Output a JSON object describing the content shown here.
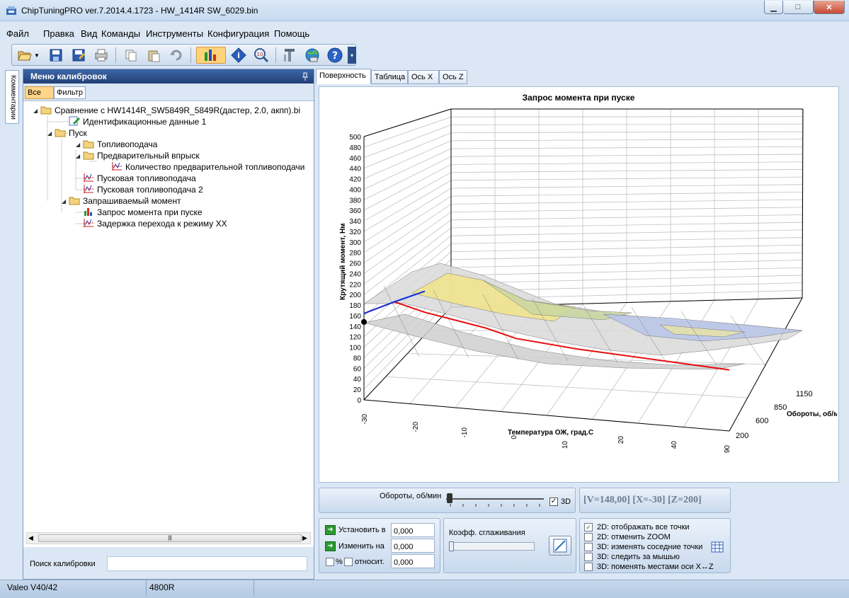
{
  "window": {
    "title": "ChipTuningPRO ver.7.2014.4.1723 - HW_1414R SW_6029.bin",
    "min_glyph": "▁",
    "max_glyph": "□",
    "close_glyph": "✕"
  },
  "menu": [
    "Файл",
    "Правка",
    "Вид",
    "Команды",
    "Инструменты",
    "Конфигурация",
    "Помощь"
  ],
  "side_tab": "Комментарии",
  "left_panel": {
    "title": "Меню калибровок",
    "filter_buttons": [
      "Все",
      "Фильтр"
    ],
    "tree": [
      {
        "label": "Сравнение с HW1414R_SW5849R_5849R(дастер, 2.0, акпп).bi",
        "icon": "folder-icon",
        "level": 0,
        "expand": "◢"
      },
      {
        "label": "Идентификационные данные 1",
        "icon": "edit-icon",
        "level": 1,
        "expand": ""
      },
      {
        "label": "Пуск",
        "icon": "folder-icon",
        "level": 1,
        "expand": "◢"
      },
      {
        "label": "Топливоподача",
        "icon": "folder-icon",
        "level": 2,
        "expand": "◢"
      },
      {
        "label": "Предварительный впрыск",
        "icon": "folder-icon",
        "level": 3,
        "expand": "◢"
      },
      {
        "label": "Количество предварительной топливоподачи",
        "icon": "chart-line-icon",
        "level": 4,
        "expand": ""
      },
      {
        "label": "Пусковая топливоподача",
        "icon": "chart-line-icon",
        "level": 3,
        "expand": ""
      },
      {
        "label": "Пусковая топливоподача 2",
        "icon": "chart-line-icon",
        "level": 3,
        "expand": ""
      },
      {
        "label": "Запрашиваемый момент",
        "icon": "folder-icon",
        "level": 2,
        "expand": "◢"
      },
      {
        "label": "Запрос момента при пуске",
        "icon": "chart-3d-icon",
        "level": 3,
        "expand": ""
      },
      {
        "label": "Задержка перехода к режиму XX",
        "icon": "chart-line-icon",
        "level": 3,
        "expand": ""
      }
    ],
    "search_label": "Поиск калибровки",
    "search_value": "",
    "scroll_grip": "|||"
  },
  "tabs": [
    "Поверхность",
    "Таблица",
    "Ось X",
    "Ось Z"
  ],
  "chart_data": {
    "type": "surface3d",
    "title": "Запрос момента при пуске",
    "zlabel": "Крутящий момент, Нм",
    "xlabel": "Температура ОЖ, град.С",
    "ylabel": "Обороты, об/м",
    "z_ticks": [
      "0",
      "20",
      "40",
      "60",
      "80",
      "100",
      "120",
      "140",
      "160",
      "180",
      "200",
      "220",
      "240",
      "260",
      "280",
      "300",
      "320",
      "340",
      "360",
      "380",
      "400",
      "420",
      "440",
      "460",
      "480",
      "500"
    ],
    "x_ticks": [
      "-30",
      "-20",
      "-10",
      "0",
      "10",
      "20",
      "40",
      "90"
    ],
    "y_ticks": [
      "200",
      "600",
      "850",
      "1150"
    ],
    "zlim": [
      0,
      500
    ],
    "highlight_value": 148,
    "series": [
      {
        "color": "#e81010",
        "x": [
          -30,
          -20,
          -10,
          0,
          10,
          20,
          40,
          90
        ],
        "y": 1150,
        "z": [
          148,
          175,
          160,
          150,
          140,
          125,
          115,
          100
        ]
      },
      {
        "color": "#1030e0",
        "x": [
          -30,
          -20,
          -10
        ],
        "y": 1150,
        "z": [
          148,
          175,
          200
        ]
      }
    ]
  },
  "controls": {
    "rpm_label": "Обороты, об/мин",
    "check3d_label": "3D",
    "check3d_mark": "✓",
    "readout": "[V=148,00] [X=-30] [Z=200]",
    "set_label": "Установить в",
    "set_value": "0,000",
    "change_label": "Изменить на",
    "change_value": "0,000",
    "percent_label": "%",
    "relative_label": "относит.",
    "relative_value": "0,000",
    "smoothing_label": "Коэфф. сглаживания",
    "options": [
      {
        "label": "2D: отображать все точки",
        "checked": true
      },
      {
        "label": "2D: отменить ZOOM",
        "checked": false
      },
      {
        "label": "3D: изменять соседние точки",
        "checked": false
      },
      {
        "label": "3D: следить за мышью",
        "checked": false
      },
      {
        "label": "3D: поменять местами оси X↔Z",
        "checked": false
      }
    ]
  },
  "status": {
    "ecu": "Valeo V40/42",
    "sw": "4800R"
  }
}
